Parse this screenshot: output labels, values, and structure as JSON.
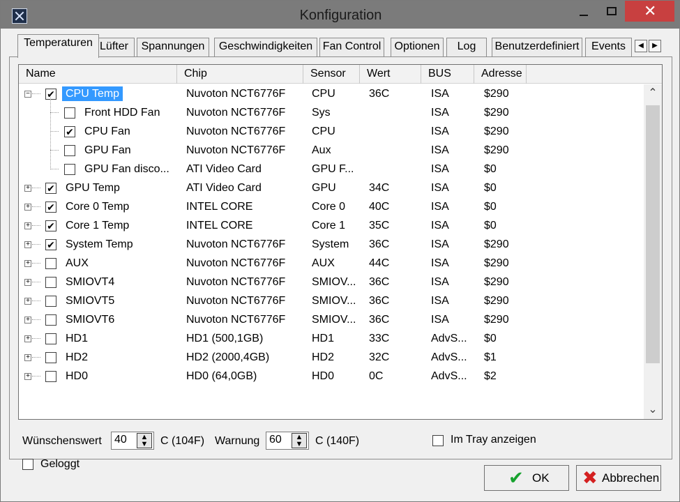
{
  "window": {
    "title": "Konfiguration",
    "close_glyph": "✕",
    "accent": "#3399ff",
    "close_color": "#c84040"
  },
  "tabs": [
    "Temperaturen",
    "Lüfter",
    "Spannungen",
    "Geschwindigkeiten",
    "Fan Control",
    "Optionen",
    "Log",
    "Benutzerdefiniert",
    "Events"
  ],
  "active_tab": "Temperaturen",
  "tab_scroll": {
    "left": "◀",
    "right": "▶"
  },
  "columns": [
    "Name",
    "Chip",
    "Sensor",
    "Wert",
    "BUS",
    "Adresse"
  ],
  "rows": [
    {
      "level": 0,
      "expander": "−",
      "checked": true,
      "selected": true,
      "name": "CPU Temp",
      "chip": "Nuvoton NCT6776F",
      "sensor": "CPU",
      "wert": "36C",
      "bus": "ISA",
      "adresse": "$290"
    },
    {
      "level": 1,
      "expander": "",
      "checked": false,
      "selected": false,
      "name": "Front HDD Fan",
      "chip": "Nuvoton NCT6776F",
      "sensor": "Sys",
      "wert": "",
      "bus": "ISA",
      "adresse": "$290"
    },
    {
      "level": 1,
      "expander": "",
      "checked": true,
      "selected": false,
      "name": "CPU Fan",
      "chip": "Nuvoton NCT6776F",
      "sensor": "CPU",
      "wert": "",
      "bus": "ISA",
      "adresse": "$290"
    },
    {
      "level": 1,
      "expander": "",
      "checked": false,
      "selected": false,
      "name": "GPU Fan",
      "chip": "Nuvoton NCT6776F",
      "sensor": "Aux",
      "wert": "",
      "bus": "ISA",
      "adresse": "$290"
    },
    {
      "level": 1,
      "expander": "",
      "checked": false,
      "selected": false,
      "name": "GPU Fan disco...",
      "chip": "ATI Video Card",
      "sensor": "GPU F...",
      "wert": "",
      "bus": "ISA",
      "adresse": "$0"
    },
    {
      "level": 0,
      "expander": "+",
      "checked": true,
      "selected": false,
      "name": "GPU Temp",
      "chip": "ATI Video Card",
      "sensor": "GPU",
      "wert": "34C",
      "bus": "ISA",
      "adresse": "$0"
    },
    {
      "level": 0,
      "expander": "+",
      "checked": true,
      "selected": false,
      "name": "Core 0 Temp",
      "chip": "INTEL CORE",
      "sensor": "Core 0",
      "wert": "40C",
      "bus": "ISA",
      "adresse": "$0"
    },
    {
      "level": 0,
      "expander": "+",
      "checked": true,
      "selected": false,
      "name": "Core 1 Temp",
      "chip": "INTEL CORE",
      "sensor": "Core 1",
      "wert": "35C",
      "bus": "ISA",
      "adresse": "$0"
    },
    {
      "level": 0,
      "expander": "+",
      "checked": true,
      "selected": false,
      "name": "System Temp",
      "chip": "Nuvoton NCT6776F",
      "sensor": "System",
      "wert": "36C",
      "bus": "ISA",
      "adresse": "$290"
    },
    {
      "level": 0,
      "expander": "+",
      "checked": false,
      "selected": false,
      "name": "AUX",
      "chip": "Nuvoton NCT6776F",
      "sensor": "AUX",
      "wert": "44C",
      "bus": "ISA",
      "adresse": "$290"
    },
    {
      "level": 0,
      "expander": "+",
      "checked": false,
      "selected": false,
      "name": "SMIOVT4",
      "chip": "Nuvoton NCT6776F",
      "sensor": "SMIOV...",
      "wert": "36C",
      "bus": "ISA",
      "adresse": "$290"
    },
    {
      "level": 0,
      "expander": "+",
      "checked": false,
      "selected": false,
      "name": "SMIOVT5",
      "chip": "Nuvoton NCT6776F",
      "sensor": "SMIOV...",
      "wert": "36C",
      "bus": "ISA",
      "adresse": "$290"
    },
    {
      "level": 0,
      "expander": "+",
      "checked": false,
      "selected": false,
      "name": "SMIOVT6",
      "chip": "Nuvoton NCT6776F",
      "sensor": "SMIOV...",
      "wert": "36C",
      "bus": "ISA",
      "adresse": "$290"
    },
    {
      "level": 0,
      "expander": "+",
      "checked": false,
      "selected": false,
      "name": "HD1",
      "chip": "HD1 (500,1GB)",
      "sensor": "HD1",
      "wert": "33C",
      "bus": "AdvS...",
      "adresse": "$0"
    },
    {
      "level": 0,
      "expander": "+",
      "checked": false,
      "selected": false,
      "name": "HD2",
      "chip": "HD2 (2000,4GB)",
      "sensor": "HD2",
      "wert": "32C",
      "bus": "AdvS...",
      "adresse": "$1"
    },
    {
      "level": 0,
      "expander": "+",
      "checked": false,
      "selected": false,
      "name": "HD0",
      "chip": "HD0 (64,0GB)",
      "sensor": "HD0",
      "wert": "0C",
      "bus": "AdvS...",
      "adresse": "$2"
    }
  ],
  "scrollbar": {
    "up": "⌃",
    "down": "⌄"
  },
  "settings": {
    "target_label": "Wünschenswert",
    "target_value": "40",
    "target_unit": "C (104F)",
    "warning_label": "Warnung",
    "warning_value": "60",
    "warning_unit": "C (140F)",
    "tray_label": "Im Tray anzeigen",
    "tray_checked": false,
    "logged_label": "Geloggt",
    "logged_checked": false,
    "spin_up": "▲",
    "spin_down": "▼"
  },
  "buttons": {
    "ok_icon": "✔",
    "ok_label": "OK",
    "cancel_icon": "✖",
    "cancel_label": "Abbrechen"
  }
}
